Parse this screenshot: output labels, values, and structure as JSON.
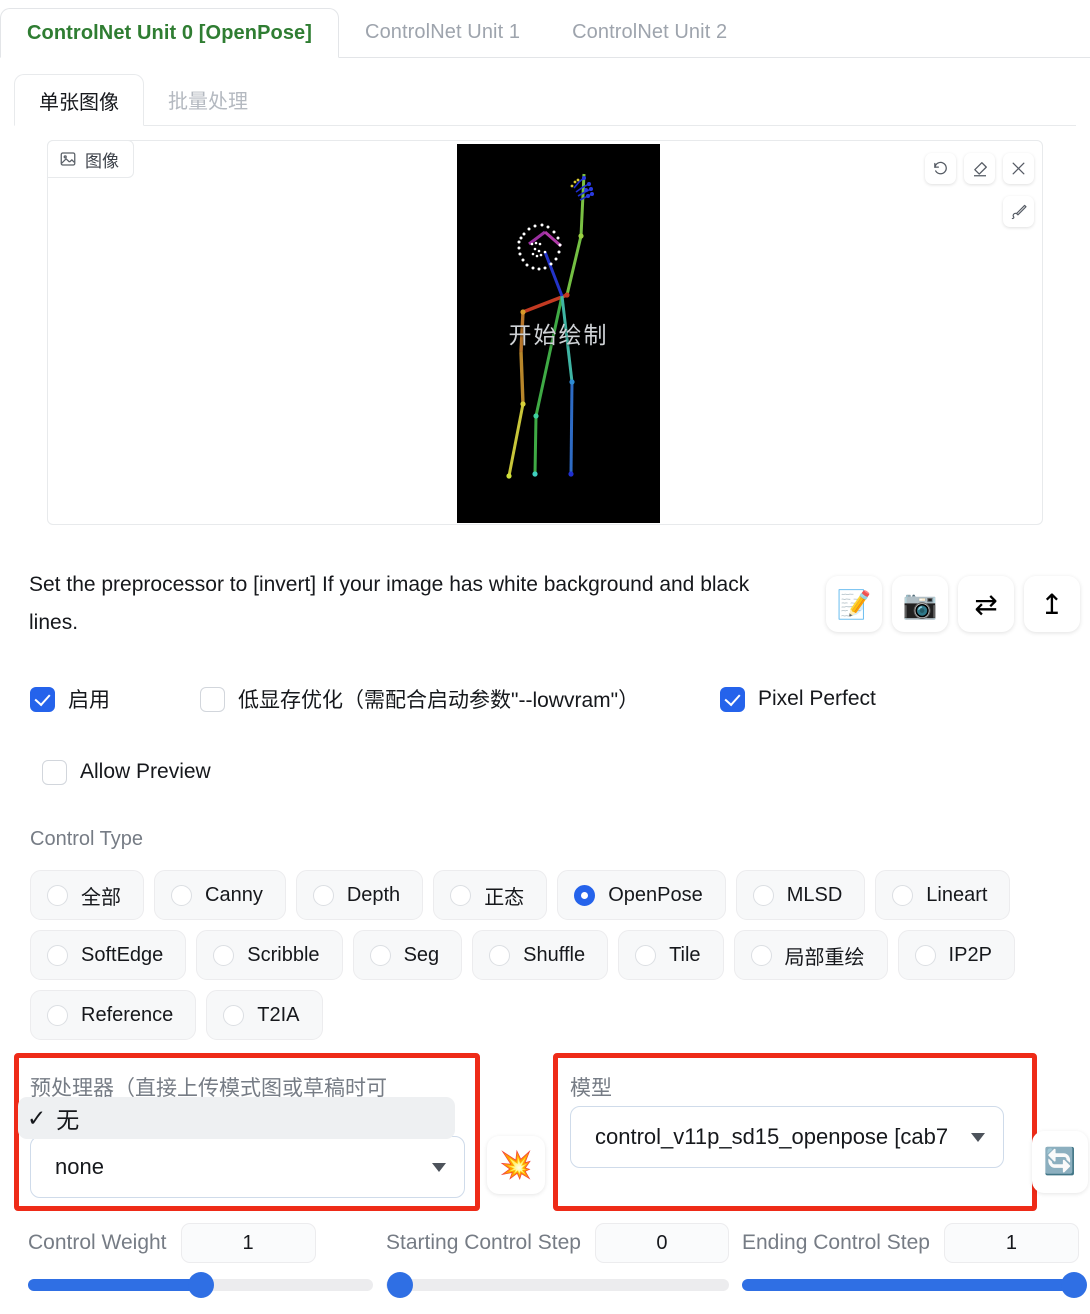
{
  "unit_tabs": [
    {
      "label": "ControlNet Unit 0 [OpenPose]",
      "active": true
    },
    {
      "label": "ControlNet Unit 1",
      "active": false
    },
    {
      "label": "ControlNet Unit 2",
      "active": false
    }
  ],
  "sub_tabs": [
    {
      "label": "单张图像",
      "active": true
    },
    {
      "label": "批量处理",
      "active": false
    }
  ],
  "image_panel": {
    "chip_label": "图像",
    "overlay_text": "开始绘制",
    "tools": [
      {
        "name": "undo-icon",
        "title": "撤销"
      },
      {
        "name": "eraser-icon",
        "title": "橡皮擦"
      },
      {
        "name": "close-icon",
        "title": "关闭"
      }
    ],
    "brush_tool": {
      "name": "brush-icon",
      "title": "画笔"
    }
  },
  "hint": {
    "text": "Set the preprocessor to [invert] If your image has white background and black lines.",
    "buttons": [
      {
        "name": "edit-memo-button",
        "glyph": "📝"
      },
      {
        "name": "camera-button",
        "glyph": "📷"
      },
      {
        "name": "swap-button",
        "glyph": "⇄"
      },
      {
        "name": "upload-button",
        "glyph": "↥"
      }
    ]
  },
  "checkboxes": {
    "row1": [
      {
        "label": "启用",
        "checked": true
      },
      {
        "label": "低显存优化（需配合启动参数\"--lowvram\"）",
        "checked": false
      },
      {
        "label": "Pixel Perfect",
        "checked": true
      }
    ],
    "row2": [
      {
        "label": "Allow Preview",
        "checked": false
      }
    ]
  },
  "control_type": {
    "label": "Control Type",
    "rows": [
      [
        {
          "label": "全部",
          "selected": false
        },
        {
          "label": "Canny",
          "selected": false
        },
        {
          "label": "Depth",
          "selected": false
        },
        {
          "label": "正态",
          "selected": false
        },
        {
          "label": "OpenPose",
          "selected": true
        },
        {
          "label": "MLSD",
          "selected": false
        },
        {
          "label": "Lineart",
          "selected": false
        }
      ],
      [
        {
          "label": "SoftEdge",
          "selected": false
        },
        {
          "label": "Scribble",
          "selected": false
        },
        {
          "label": "Seg",
          "selected": false
        },
        {
          "label": "Shuffle",
          "selected": false
        },
        {
          "label": "Tile",
          "selected": false
        },
        {
          "label": "局部重绘",
          "selected": false
        },
        {
          "label": "IP2P",
          "selected": false
        }
      ],
      [
        {
          "label": "Reference",
          "selected": false
        },
        {
          "label": "T2IA",
          "selected": false
        }
      ]
    ]
  },
  "preprocessor": {
    "label": "预处理器（直接上传模式图或草稿时可",
    "value": "none",
    "open_option": "无",
    "open_option_check": "✓",
    "highlight_color": "#ee2b18"
  },
  "model": {
    "label": "模型",
    "value": "control_v11p_sd15_openpose [cab7",
    "highlight_color": "#ee2b18"
  },
  "side_buttons": {
    "burst": {
      "name": "burst-button",
      "glyph": "💥"
    },
    "refresh": {
      "name": "refresh-button",
      "glyph": "🔄"
    }
  },
  "sliders": [
    {
      "label": "Control Weight",
      "value": "1",
      "percent": 50
    },
    {
      "label": "Starting Control Step",
      "value": "0",
      "percent": 0
    },
    {
      "label": "Ending Control Step",
      "value": "1",
      "percent": 100
    }
  ],
  "colors": {
    "accent_blue": "#2563eb",
    "slider_blue": "#2f6fe4",
    "active_tab_green": "#2f7d32",
    "muted_text": "#9ea4ad",
    "red_highlight": "#ee2b18"
  }
}
